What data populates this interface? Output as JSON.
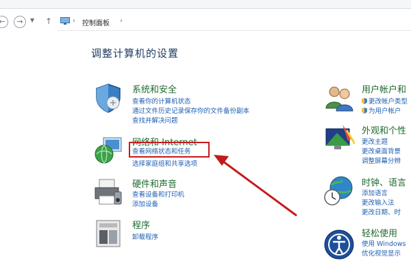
{
  "address": {
    "back_icon": "back-arrow-icon",
    "forward_icon": "forward-arrow-icon",
    "up_icon": "up-arrow-icon",
    "breadcrumb_root": "控制面板"
  },
  "page": {
    "title": "调整计算机的设置"
  },
  "left_categories": [
    {
      "title": "系统和安全",
      "links": [
        "查看你的计算机状态",
        "通过文件历史记录保存你的文件备份副本",
        "查找并解决问题"
      ]
    },
    {
      "title": "网络和 Internet",
      "links": [
        "查看网络状态和任务",
        "选择家庭组和共享选项"
      ]
    },
    {
      "title": "硬件和声音",
      "links": [
        "查看设备和打印机",
        "添加设备"
      ]
    },
    {
      "title": "程序",
      "links": [
        "卸载程序"
      ]
    }
  ],
  "right_categories": [
    {
      "title": "用户帐户和",
      "links": [
        "更改帐户类型",
        "为用户帐户"
      ]
    },
    {
      "title": "外观和个性",
      "links": [
        "更改主题",
        "更改桌面背景",
        "调整屏幕分辨"
      ]
    },
    {
      "title": "时钟、语言",
      "links": [
        "添加语言",
        "更改输入法",
        "更改日期、时"
      ]
    },
    {
      "title": "轻松使用",
      "links": [
        "使用 Windows",
        "优化视觉显示"
      ]
    }
  ],
  "colors": {
    "highlight": "#c41a1a",
    "link": "#1f5fb3",
    "category_title": "#1e6a2e"
  }
}
